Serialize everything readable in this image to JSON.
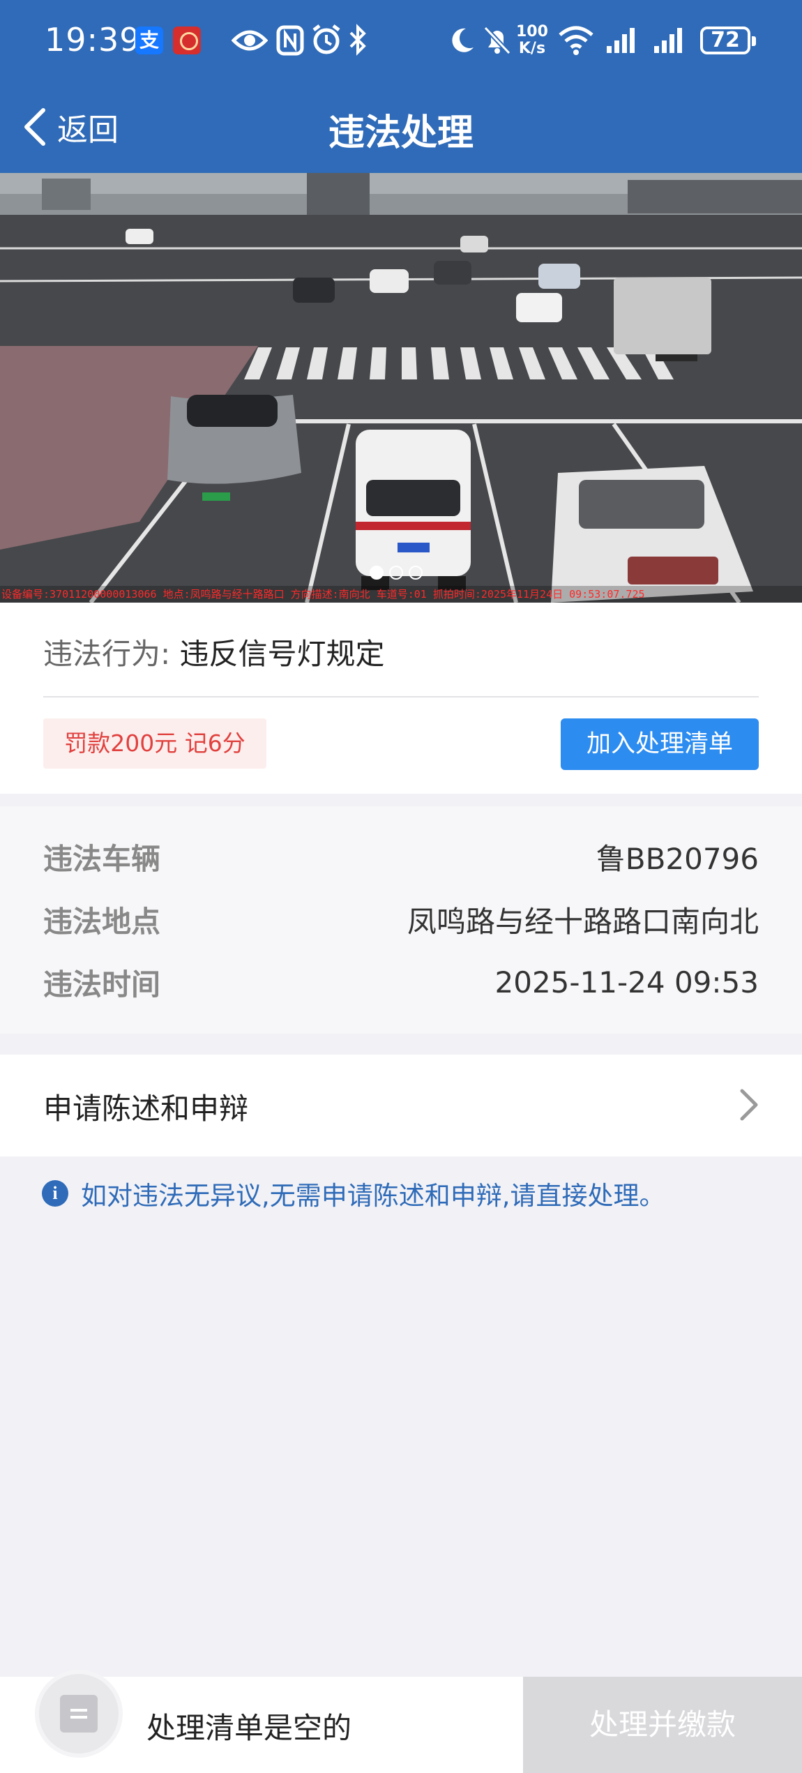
{
  "status_bar": {
    "time": "19:39",
    "alipay_glyph": "支",
    "net_speed_value": "100",
    "net_speed_unit": "K/s",
    "battery": "72",
    "icons": [
      "alipay-icon",
      "app-red-icon",
      "eye-icon",
      "nfc-icon",
      "alarm-icon",
      "bluetooth-icon",
      "moon-icon",
      "mute-bell-icon",
      "wifi-icon",
      "signal-icon",
      "signal-icon",
      "battery-icon"
    ]
  },
  "header": {
    "back_label": "返回",
    "title": "违法处理",
    "background_color": "#2f6bb8"
  },
  "photo": {
    "caption": "设备编号:37011200000013066 地点:凤鸣路与经十路路口 方向描述:南向北 车道号:01 抓拍时间:2025年11月24日 09:53:07.725",
    "pages": 3,
    "current_page": 1
  },
  "violation": {
    "behavior_label": "违法行为:",
    "behavior_value": "违反信号灯规定",
    "penalty": "罚款200元 记6分",
    "add_button": "加入处理清单"
  },
  "details": {
    "vehicle_label": "违法车辆",
    "vehicle_value": "鲁BB20796",
    "location_label": "违法地点",
    "location_value": "凤鸣路与经十路路口南向北",
    "time_label": "违法时间",
    "time_value": "2025-11-24 09:53"
  },
  "appeal": {
    "label": "申请陈述和申辩"
  },
  "notice": {
    "icon_glyph": "i",
    "text": "如对违法无异议,无需申请陈述和申辩,请直接处理。"
  },
  "bottom_bar": {
    "cart_text": "处理清单是空的",
    "pay_button": "处理并缴款"
  },
  "colors": {
    "accent_blue": "#2d8cf0",
    "penalty_red": "#e0413e",
    "disabled_button": "#d9d9dc"
  }
}
